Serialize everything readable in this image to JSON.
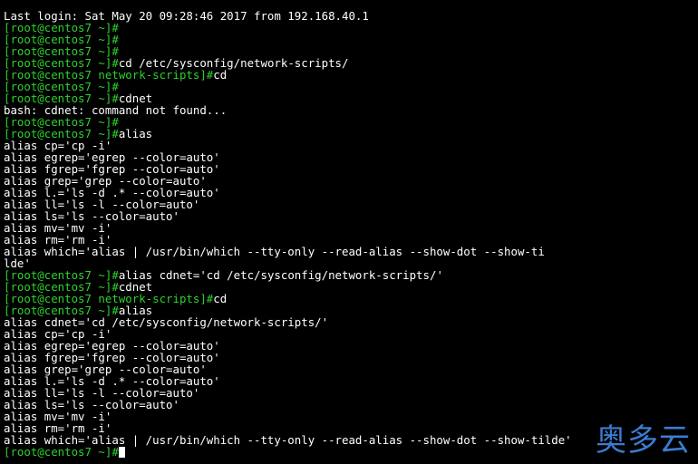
{
  "colors": {
    "background": "#000000",
    "text": "#ffffff",
    "prompt": "#2fd12f",
    "watermark": "#3b7cd1"
  },
  "terminal": {
    "lines": [
      {
        "text": "Last login: Sat May 20 09:28:46 2017 from 192.168.40.1"
      },
      {
        "prompt": "[root@centos7 ~]#",
        "text": ""
      },
      {
        "prompt": "[root@centos7 ~]#",
        "text": ""
      },
      {
        "prompt": "[root@centos7 ~]#",
        "text": ""
      },
      {
        "prompt": "[root@centos7 ~]#",
        "text": "cd /etc/sysconfig/network-scripts/"
      },
      {
        "prompt": "[root@centos7 network-scripts]#",
        "text": "cd"
      },
      {
        "prompt": "[root@centos7 ~]#",
        "text": ""
      },
      {
        "prompt": "[root@centos7 ~]#",
        "text": "cdnet"
      },
      {
        "text": "bash: cdnet: command not found..."
      },
      {
        "prompt": "[root@centos7 ~]#",
        "text": ""
      },
      {
        "prompt": "[root@centos7 ~]#",
        "text": "alias"
      },
      {
        "text": "alias cp='cp -i'"
      },
      {
        "text": "alias egrep='egrep --color=auto'"
      },
      {
        "text": "alias fgrep='fgrep --color=auto'"
      },
      {
        "text": "alias grep='grep --color=auto'"
      },
      {
        "text": "alias l.='ls -d .* --color=auto'"
      },
      {
        "text": "alias ll='ls -l --color=auto'"
      },
      {
        "text": "alias ls='ls --color=auto'"
      },
      {
        "text": "alias mv='mv -i'"
      },
      {
        "text": "alias rm='rm -i'"
      },
      {
        "text": "alias which='alias | /usr/bin/which --tty-only --read-alias --show-dot --show-ti"
      },
      {
        "text": "lde'"
      },
      {
        "prompt": "[root@centos7 ~]#",
        "text": "alias cdnet='cd /etc/sysconfig/network-scripts/'"
      },
      {
        "prompt": "[root@centos7 ~]#",
        "text": "cdnet"
      },
      {
        "prompt": "[root@centos7 network-scripts]#",
        "text": "cd"
      },
      {
        "prompt": "[root@centos7 ~]#",
        "text": "alias"
      },
      {
        "text": "alias cdnet='cd /etc/sysconfig/network-scripts/'"
      },
      {
        "text": "alias cp='cp -i'"
      },
      {
        "text": "alias egrep='egrep --color=auto'"
      },
      {
        "text": "alias fgrep='fgrep --color=auto'"
      },
      {
        "text": "alias grep='grep --color=auto'"
      },
      {
        "text": "alias l.='ls -d .* --color=auto'"
      },
      {
        "text": "alias ll='ls -l --color=auto'"
      },
      {
        "text": "alias ls='ls --color=auto'"
      },
      {
        "text": "alias mv='mv -i'"
      },
      {
        "text": "alias rm='rm -i'"
      },
      {
        "text": "alias which='alias | /usr/bin/which --tty-only --read-alias --show-dot --show-tilde'"
      },
      {
        "prompt": "[root@centos7 ~]#",
        "text": "",
        "cursor": true
      }
    ]
  },
  "watermark": {
    "text": "奥多云"
  }
}
